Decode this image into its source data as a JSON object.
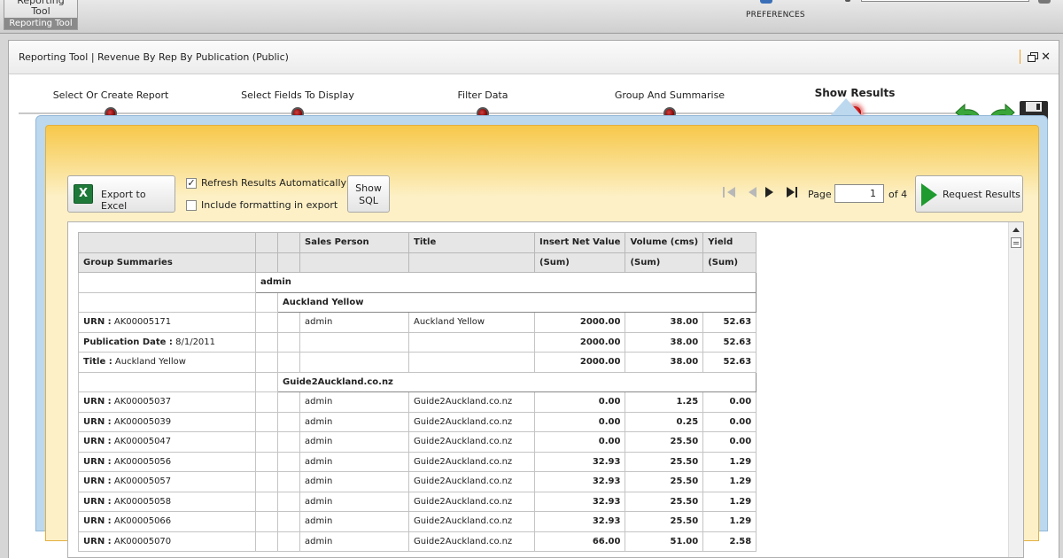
{
  "app": {
    "tile_label": "Reporting Tool",
    "tile_footer": "Reporting Tool",
    "preferences": "PREFERENCES"
  },
  "window": {
    "title": "Reporting Tool | Revenue By Rep By Publication (Public)"
  },
  "wizard": {
    "steps": [
      {
        "label": "Select Or Create Report",
        "active": false
      },
      {
        "label": "Select Fields To Display",
        "active": false
      },
      {
        "label": "Filter Data",
        "active": false
      },
      {
        "label": "Group And Summarise",
        "active": false
      },
      {
        "label": "Show Results",
        "active": true
      }
    ]
  },
  "toolbar": {
    "export_label": "Export to Excel",
    "refresh_label": "Refresh Results Automatically",
    "refresh_checked": true,
    "formatting_label": "Include formatting in export",
    "formatting_checked": false,
    "show_sql_line1": "Show",
    "show_sql_line2": "SQL",
    "page_label": "Page",
    "page_value": "1",
    "of_label": "of 4",
    "request_label": "Request Results"
  },
  "table": {
    "headers": [
      "Sales Person",
      "Title",
      "Insert Net Value",
      "Volume (cms)",
      "Yield"
    ],
    "group_summaries_label": "Group Summaries",
    "sum_label": "(Sum)",
    "group_admin": "admin",
    "group_auckland": "Auckland Yellow",
    "group_guide": "Guide2Auckland.co.nz",
    "auckland_rows": [
      {
        "key": "URN :",
        "val": "AK00005171",
        "sp": "admin",
        "title": "Auckland Yellow",
        "inv": "2000.00",
        "vol": "38.00",
        "yield": "52.63"
      },
      {
        "key": "Publication Date :",
        "val": "8/1/2011",
        "sp": "",
        "title": "",
        "inv": "2000.00",
        "vol": "38.00",
        "yield": "52.63"
      },
      {
        "key": "Title :",
        "val": "Auckland Yellow",
        "sp": "",
        "title": "",
        "inv": "2000.00",
        "vol": "38.00",
        "yield": "52.63"
      }
    ],
    "guide_rows": [
      {
        "key": "URN :",
        "val": "AK00005037",
        "sp": "admin",
        "title": "Guide2Auckland.co.nz",
        "inv": "0.00",
        "vol": "1.25",
        "yield": "0.00"
      },
      {
        "key": "URN :",
        "val": "AK00005039",
        "sp": "admin",
        "title": "Guide2Auckland.co.nz",
        "inv": "0.00",
        "vol": "0.25",
        "yield": "0.00"
      },
      {
        "key": "URN :",
        "val": "AK00005047",
        "sp": "admin",
        "title": "Guide2Auckland.co.nz",
        "inv": "0.00",
        "vol": "25.50",
        "yield": "0.00"
      },
      {
        "key": "URN :",
        "val": "AK00005056",
        "sp": "admin",
        "title": "Guide2Auckland.co.nz",
        "inv": "32.93",
        "vol": "25.50",
        "yield": "1.29"
      },
      {
        "key": "URN :",
        "val": "AK00005057",
        "sp": "admin",
        "title": "Guide2Auckland.co.nz",
        "inv": "32.93",
        "vol": "25.50",
        "yield": "1.29"
      },
      {
        "key": "URN :",
        "val": "AK00005058",
        "sp": "admin",
        "title": "Guide2Auckland.co.nz",
        "inv": "32.93",
        "vol": "25.50",
        "yield": "1.29"
      },
      {
        "key": "URN :",
        "val": "AK00005066",
        "sp": "admin",
        "title": "Guide2Auckland.co.nz",
        "inv": "32.93",
        "vol": "25.50",
        "yield": "1.29"
      },
      {
        "key": "URN :",
        "val": "AK00005070",
        "sp": "admin",
        "title": "Guide2Auckland.co.nz",
        "inv": "66.00",
        "vol": "51.00",
        "yield": "2.58"
      }
    ]
  }
}
